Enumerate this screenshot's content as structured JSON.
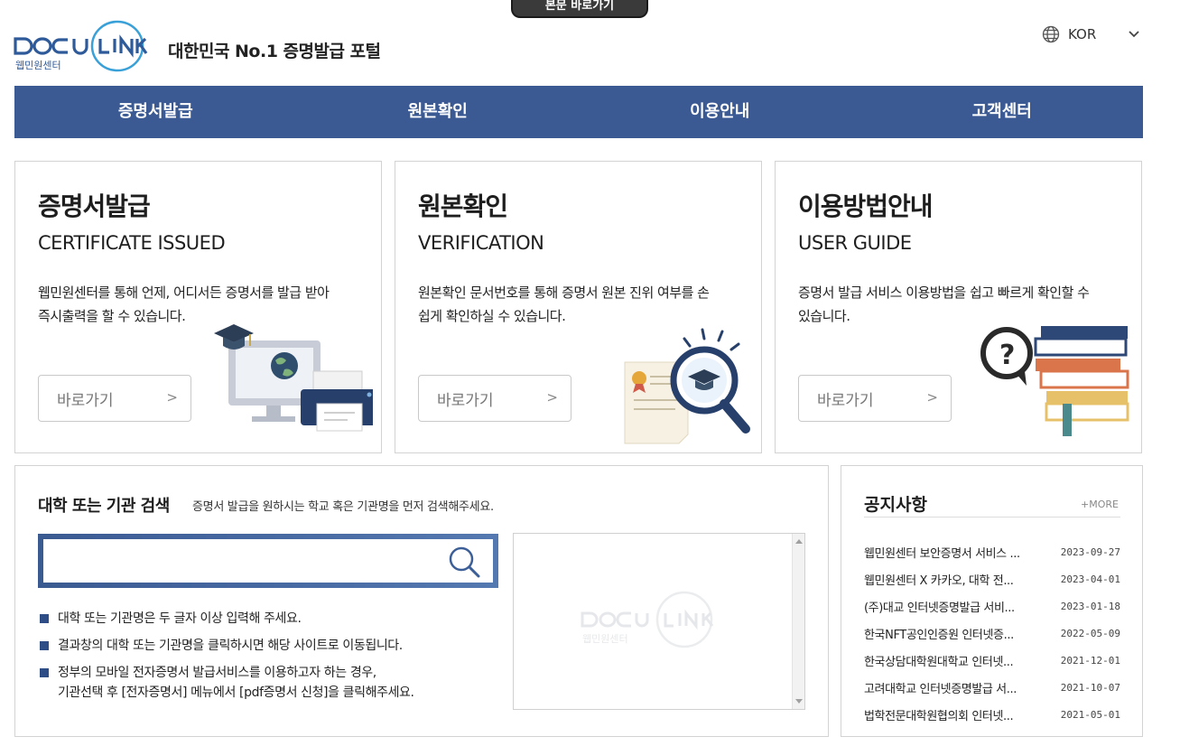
{
  "skip_link": "본문 바로가기",
  "header": {
    "logo_text": "DOCU LINK",
    "logo_sub": "웹민원센터",
    "tagline": "대한민국 No.1 증명발급 포털",
    "language": "KOR"
  },
  "nav": {
    "items": [
      {
        "label": "증명서발급"
      },
      {
        "label": "원본확인"
      },
      {
        "label": "이용안내"
      },
      {
        "label": "고객센터"
      }
    ]
  },
  "cards": [
    {
      "title": "증명서발급",
      "subtitle": "CERTIFICATE ISSUED",
      "desc_line1": "웹민원센터를 통해 언제, 어디서든 증명서를 발급 받아",
      "desc_line2": "즉시출력을 할 수 있습니다.",
      "button": "바로가기",
      "arrow": ">",
      "icon": "printer-computer-icon"
    },
    {
      "title": "원본확인",
      "subtitle": "VERIFICATION",
      "desc_line1": "원본확인 문서번호를 통해 증명서 원본 진위 여부를 손",
      "desc_line2": "쉽게 확인하실 수 있습니다.",
      "button": "바로가기",
      "arrow": ">",
      "icon": "magnifier-certificate-icon"
    },
    {
      "title": "이용방법안내",
      "subtitle": "USER GUIDE",
      "desc_line1": "증명서 발급 서비스 이용방법을 쉽고 빠르게 확인할 수",
      "desc_line2": "있습니다.",
      "button": "바로가기",
      "arrow": ">",
      "icon": "books-question-icon"
    }
  ],
  "search": {
    "title": "대학 또는 기관 검색",
    "hint": "증명서 발급을 원하시는 학교 혹은 기관명을 먼저 검색해주세요.",
    "placeholder": "",
    "tips": [
      "대학 또는 기관명은 두 글자 이상 입력해 주세요.",
      "결과창의 대학 또는 기관명을 클릭하시면 해당 사이트로 이동됩니다.",
      "정부의 모바일 전자증명서 발급서비스를 이용하고자 하는 경우,"
    ],
    "tip3_line2": "기관선택 후 [전자증명서] 메뉴에서 [pdf증명서 신청]을 클릭해주세요.",
    "results_watermark": "DOCU LINK",
    "results_watermark_sub": "웹민원센터"
  },
  "notice": {
    "title": "공지사항",
    "more": "+MORE",
    "items": [
      {
        "title": "웹민원센터 보안증명서 서비스 ...",
        "date": "2023-09-27"
      },
      {
        "title": "웹민원센터 X 카카오, 대학 전...",
        "date": "2023-04-01"
      },
      {
        "title": "(주)대교 인터넷증명발급 서비...",
        "date": "2023-01-18"
      },
      {
        "title": "한국NFT공인인증원 인터넷증...",
        "date": "2022-05-09"
      },
      {
        "title": "한국상담대학원대학교 인터넷...",
        "date": "2021-12-01"
      },
      {
        "title": "고려대학교 인터넷증명발급 서...",
        "date": "2021-10-07"
      },
      {
        "title": "법학전문대학원협의회 인터넷...",
        "date": "2021-05-01"
      }
    ]
  },
  "colors": {
    "nav_bg": "#3b5a94",
    "accent_blue": "#2e4c86",
    "logo_blue": "#3a5a92"
  }
}
